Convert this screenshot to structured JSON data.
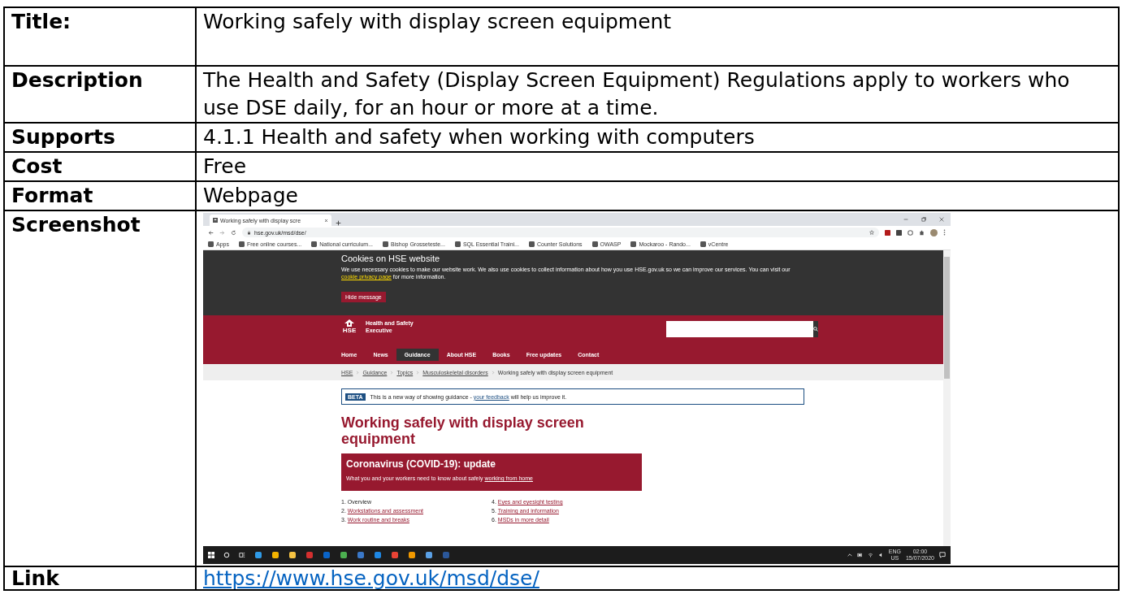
{
  "table": {
    "rows": [
      {
        "kind": "text",
        "label": "Title:",
        "value": "Working safely with display screen equipment"
      },
      {
        "kind": "text",
        "label": "Description",
        "value": "The Health and Safety (Display Screen Equipment) Regulations apply to workers who use DSE daily, for an hour or more at a time."
      },
      {
        "kind": "text",
        "label": "Supports",
        "value": "4.1.1 Health and safety when working with computers"
      },
      {
        "kind": "text",
        "label": "Cost",
        "value": "Free"
      },
      {
        "kind": "text",
        "label": "Format",
        "value": "Webpage"
      },
      {
        "kind": "screenshot",
        "label": "Screenshot"
      },
      {
        "kind": "link",
        "label": "Link",
        "value": "https://www.hse.gov.uk/msd/dse/"
      }
    ]
  },
  "screenshot": {
    "tab_title": "Working safely with display scre",
    "address": "hse.gov.uk/msd/dse/",
    "bookmarks": [
      "Apps",
      "Free online courses...",
      "National curriculum...",
      "Bishop Grosseteste...",
      "SQL Essential Traini...",
      "Counter Solutions",
      "OWASP",
      "Mockaroo - Rando...",
      "vCentre"
    ],
    "cookie": {
      "title": "Cookies on HSE website",
      "text_before": "We use necessary cookies to make our website work. We also use cookies to collect information about how you use HSE.gov.uk so we can improve our services. You can visit our ",
      "link": "cookie privacy page",
      "text_after": " for more information.",
      "button": "Hide message"
    },
    "org_name": [
      "Health and Safety",
      "Executive"
    ],
    "logo_text": "HSE",
    "nav": [
      {
        "label": "Home",
        "selected": false
      },
      {
        "label": "News",
        "selected": false
      },
      {
        "label": "Guidance",
        "selected": true
      },
      {
        "label": "About HSE",
        "selected": false
      },
      {
        "label": "Books",
        "selected": false
      },
      {
        "label": "Free updates",
        "selected": false
      },
      {
        "label": "Contact",
        "selected": false
      }
    ],
    "breadcrumb": [
      "HSE",
      "Guidance",
      "Topics",
      "Musculoskeletal disorders"
    ],
    "breadcrumb_current": "Working safely with display screen equipment",
    "beta": {
      "badge": "BETA",
      "text_before": "This is a new way of showing guidance - ",
      "link": "your feedback",
      "text_after": " will help us improve it."
    },
    "heading": "Working safely with display screen equipment",
    "covid": {
      "title": "Coronavirus (COVID-19): update",
      "text_before": "What you and your workers need to know about safely ",
      "link": "working from home"
    },
    "contents": [
      {
        "number": "1.",
        "label": "Overview",
        "link": false
      },
      {
        "number": "2.",
        "label": "Workstations and assessment",
        "link": true
      },
      {
        "number": "3.",
        "label": "Work routine and breaks",
        "link": true
      },
      {
        "number": "4.",
        "label": "Eyes and eyesight testing",
        "link": true
      },
      {
        "number": "5.",
        "label": "Training and information",
        "link": true
      },
      {
        "number": "6.",
        "label": "MSDs in more detail",
        "link": true
      }
    ],
    "tray": {
      "language": "ENG",
      "region": "US",
      "time": "02:00",
      "date": "15/07/2020"
    }
  }
}
